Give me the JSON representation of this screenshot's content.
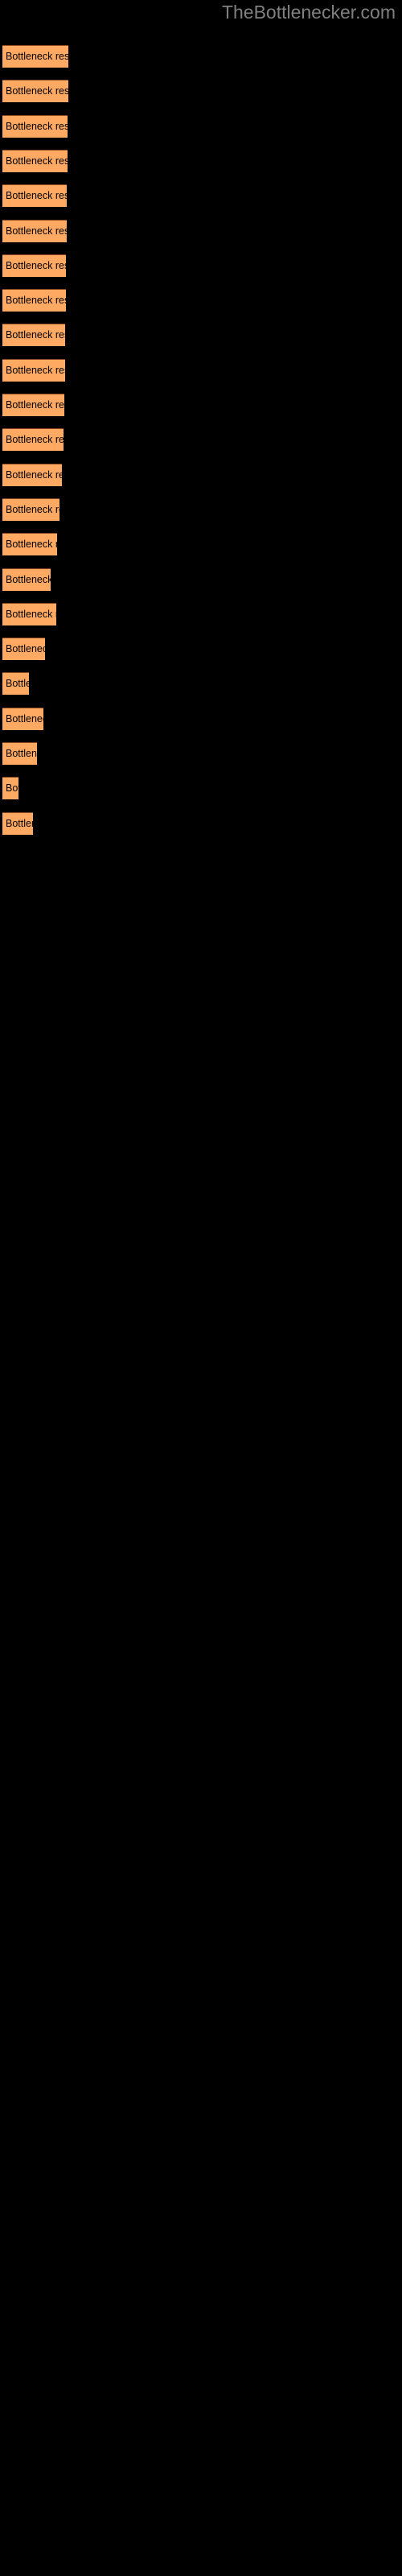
{
  "site": {
    "watermark": "TheBottlenecker.com",
    "watermark_color": "#808080"
  },
  "colors": {
    "background": "#000000",
    "bar_fill": "#ffa963",
    "bar_edge": "#8c4a22",
    "label_text": "#000000"
  },
  "chart_data": {
    "type": "bar",
    "orientation": "horizontal",
    "title": "",
    "subtitle": "",
    "xlabel": "",
    "ylabel": "",
    "grid": false,
    "legend": false,
    "axis_visible": false,
    "tick_labels": [],
    "bar_label_text": "Bottleneck result",
    "xlim": [
      0,
      100
    ],
    "categories": [
      "Bottleneck result",
      "Bottleneck result",
      "Bottleneck result",
      "Bottleneck result",
      "Bottleneck result",
      "Bottleneck result",
      "Bottleneck result",
      "Bottleneck result",
      "Bottleneck result",
      "Bottleneck result",
      "Bottleneck result",
      "Bottleneck result",
      "Bottleneck result",
      "Bottleneck result",
      "Bottleneck result",
      "Bottleneck result",
      "Bottleneck result",
      "Bottleneck result",
      "Bottleneck result",
      "Bottleneck result",
      "Bottleneck result",
      "Bottleneck result",
      "Bottleneck result"
    ],
    "values": [
      82,
      82,
      81,
      81,
      80,
      80,
      79,
      79,
      78,
      78,
      77,
      76,
      74,
      71,
      68,
      60,
      67,
      53,
      33,
      51,
      43,
      20,
      38
    ]
  },
  "bars": [
    {
      "label": "Bottleneck result",
      "value": 82,
      "y": 56,
      "width": 82
    },
    {
      "label": "Bottleneck result",
      "value": 82,
      "y": 99,
      "width": 82
    },
    {
      "label": "Bottleneck result",
      "value": 81,
      "y": 142,
      "width": 81
    },
    {
      "label": "Bottleneck result",
      "value": 81,
      "y": 185,
      "width": 81
    },
    {
      "label": "Bottleneck result",
      "value": 80,
      "y": 228,
      "width": 80
    },
    {
      "label": "Bottleneck result",
      "value": 80,
      "y": 271,
      "width": 80
    },
    {
      "label": "Bottleneck result",
      "value": 79,
      "y": 314,
      "width": 79
    },
    {
      "label": "Bottleneck result",
      "value": 79,
      "y": 357,
      "width": 79
    },
    {
      "label": "Bottleneck result",
      "value": 78,
      "y": 400,
      "width": 78
    },
    {
      "label": "Bottleneck result",
      "value": 78,
      "y": 443,
      "width": 78
    },
    {
      "label": "Bottleneck result",
      "value": 77,
      "y": 486,
      "width": 77
    },
    {
      "label": "Bottleneck result",
      "value": 76,
      "y": 529,
      "width": 76
    },
    {
      "label": "Bottleneck result",
      "value": 74,
      "y": 572,
      "width": 74
    },
    {
      "label": "Bottleneck result",
      "value": 71,
      "y": 615,
      "width": 71
    },
    {
      "label": "Bottleneck result",
      "value": 68,
      "y": 658,
      "width": 68
    },
    {
      "label": "Bottleneck result",
      "value": 60,
      "y": 701,
      "width": 45
    },
    {
      "label": "Bottleneck result",
      "value": 67,
      "y": 744,
      "width": 67
    },
    {
      "label": "Bottleneck result",
      "value": 53,
      "y": 787,
      "width": 38
    },
    {
      "label": "Bottleneck result",
      "value": 33,
      "y": 830,
      "width": 22
    },
    {
      "label": "Bottleneck result",
      "value": 51,
      "y": 873,
      "width": 40
    },
    {
      "label": "Bottleneck result",
      "value": 43,
      "y": 916,
      "width": 30
    },
    {
      "label": "Bottleneck result",
      "value": 20,
      "y": 959,
      "width": 45
    },
    {
      "label": "Bottleneck result",
      "value": 38,
      "y": 1002,
      "width": 20
    }
  ]
}
